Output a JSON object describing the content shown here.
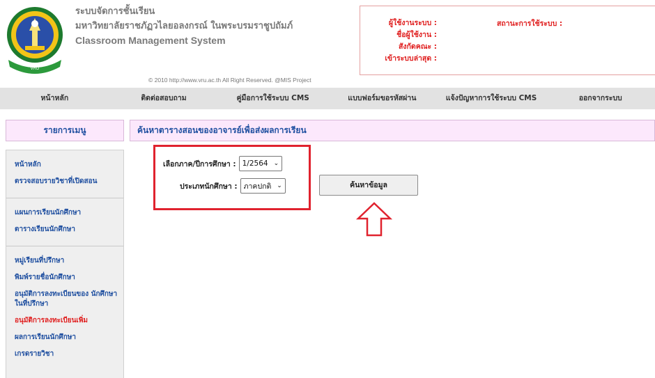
{
  "header": {
    "title_th": "ระบบจัดการชั้นเรียน",
    "university": "มหาวิทยาลัยราชภัฏวไลยอลงกรณ์ ในพระบรมราชูปถัมภ์",
    "title_en": "Classroom Management System",
    "copyright": "© 2010 http://www.vru.ac.th All Right Reserved. @MIS Project"
  },
  "user_box": {
    "labels": [
      "ผู้ใช้งานระบบ :",
      "ชื่อผู้ใช้งาน :",
      "สังกัดคณะ :",
      "เข้าระบบล่าสุด :"
    ],
    "status_label": "สถานะการใช้ระบบ :"
  },
  "topnav": {
    "items": [
      "หน้าหลัก",
      "ติดต่อสอบถาม",
      "คู่มือการใช้ระบบ CMS",
      "แบบฟอร์มขอรหัสผ่าน",
      "แจ้งปัญหาการใช้ระบบ CMS",
      "ออกจากระบบ"
    ]
  },
  "sidebar": {
    "header": "รายการเมนู",
    "groups": [
      [
        "หน้าหลัก",
        "ตรวจสอบรายวิชาที่เปิดสอน"
      ],
      [
        "แผนการเรียนนักศึกษา",
        "ตารางเรียนนักศึกษา"
      ],
      [
        "หมู่เรียนที่ปรึกษา",
        "พิมพ์รายชื่อนักศึกษา",
        "อนุมัติการลงทะเบียนของ นักศึกษาในที่ปรึกษา",
        "อนุมัติการลงทะเบียนเพิ่ม",
        "ผลการเรียนนักศึกษา",
        "เกรดรายวิชา"
      ]
    ],
    "active_item": "อนุมัติการลงทะเบียนเพิ่ม"
  },
  "main": {
    "title": "ค้นหาตารางสอนของอาจารย์เพื่อส่งผลการเรียน",
    "form": {
      "term_label": "เลือกภาค/ปีการศึกษา :",
      "term_value": "1/2564",
      "type_label": "ประเภทนักศึกษา :",
      "type_value": "ภาคปกติ"
    },
    "search_button": "ค้นหาข้อมูล"
  },
  "colors": {
    "accent_red": "#e02020",
    "link_blue": "#1f4fa0",
    "header_pink": "#fce8fc",
    "highlight_box": "#e0222e"
  },
  "icons": [
    "university-logo",
    "chevron-down-icon",
    "up-arrow-icon"
  ]
}
